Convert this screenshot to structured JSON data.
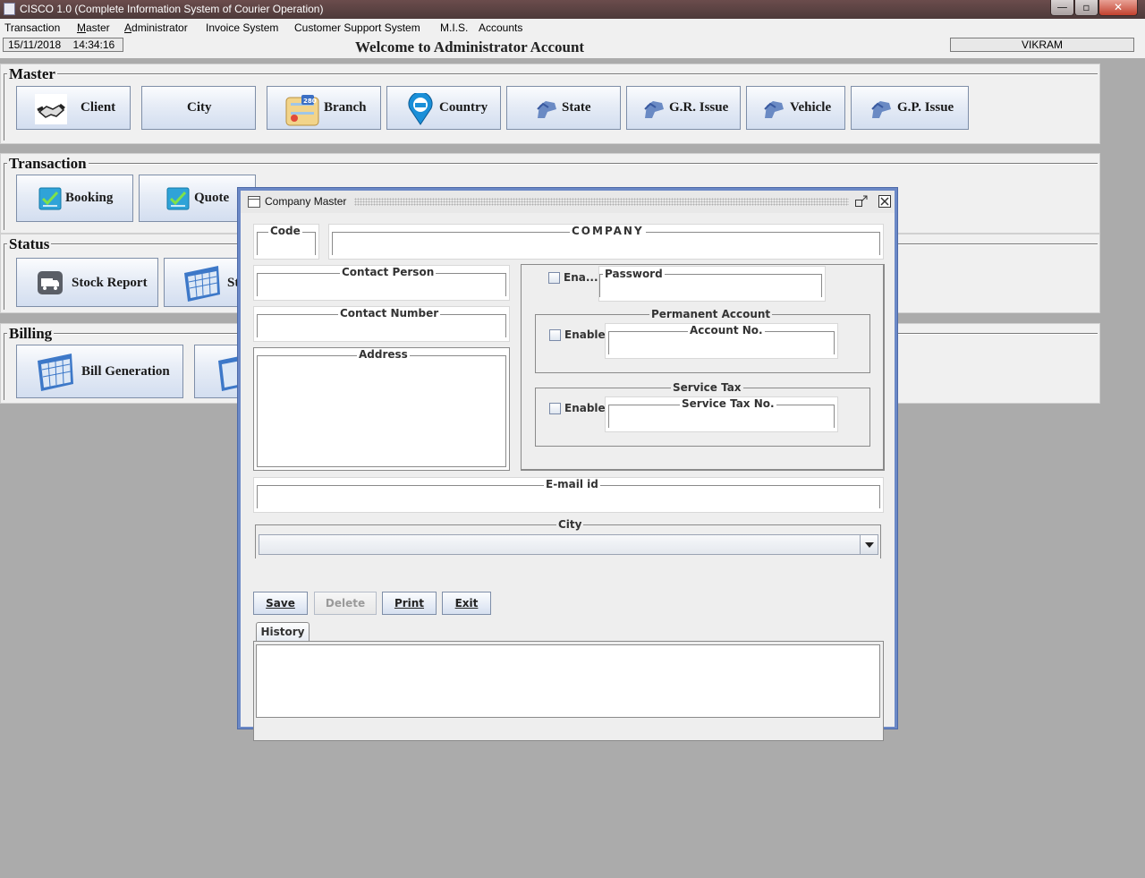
{
  "window": {
    "title": "CISCO 1.0 (Complete Information System of Courier Operation)",
    "minimize": "—",
    "maximize": "▫",
    "close": "✕"
  },
  "menu": [
    {
      "label": "Transaction",
      "underline": ""
    },
    {
      "label": "Master",
      "underline": "M"
    },
    {
      "label": "Administrator",
      "underline": "A"
    },
    {
      "label": "Invoice System",
      "underline": ""
    },
    {
      "label": "Customer Support System",
      "underline": ""
    },
    {
      "label": "M.I.S.",
      "underline": ""
    },
    {
      "label": "Accounts",
      "underline": ""
    }
  ],
  "status": {
    "date": "15/11/2018",
    "time": "14:34:16",
    "welcome": "Welcome to Administrator Account",
    "user": "VIKRAM"
  },
  "panels": {
    "master": {
      "legend": "Master",
      "buttons": [
        "Client",
        "City",
        "Branch",
        "Country",
        "State",
        "G.R. Issue",
        "Vehicle",
        "G.P. Issue"
      ]
    },
    "transaction": {
      "legend": "Transaction",
      "buttons": [
        "Booking",
        "Quote"
      ]
    },
    "status": {
      "legend": "Status",
      "buttons": [
        "Stock Report",
        "St"
      ]
    },
    "billing": {
      "legend": "Billing",
      "buttons": [
        "Bill Generation"
      ]
    }
  },
  "dialog": {
    "title": "Company Master",
    "code_label": "Code",
    "company_label": "COMPANY",
    "contact_person_label": "Contact Person",
    "contact_number_label": "Contact Number",
    "address_label": "Address",
    "enable_short": "Ena...",
    "password_label": "Password",
    "permanent_account_label": "Permanent Account",
    "enable_label": "Enable",
    "account_no_label": "Account No.",
    "service_tax_label": "Service Tax",
    "service_tax_no_label": "Service Tax No.",
    "email_label": "E-mail id",
    "city_label": "City",
    "buttons": {
      "save": "Save",
      "delete": "Delete",
      "print": "Print",
      "exit": "Exit"
    },
    "history_tab": "History"
  },
  "colors": {
    "titlebar": "#5a4242",
    "frame_border": "#6b88c6",
    "button_gradient_top": "#fbfcfe",
    "button_gradient_bottom": "#d3def0",
    "desktop": "#ababab"
  }
}
